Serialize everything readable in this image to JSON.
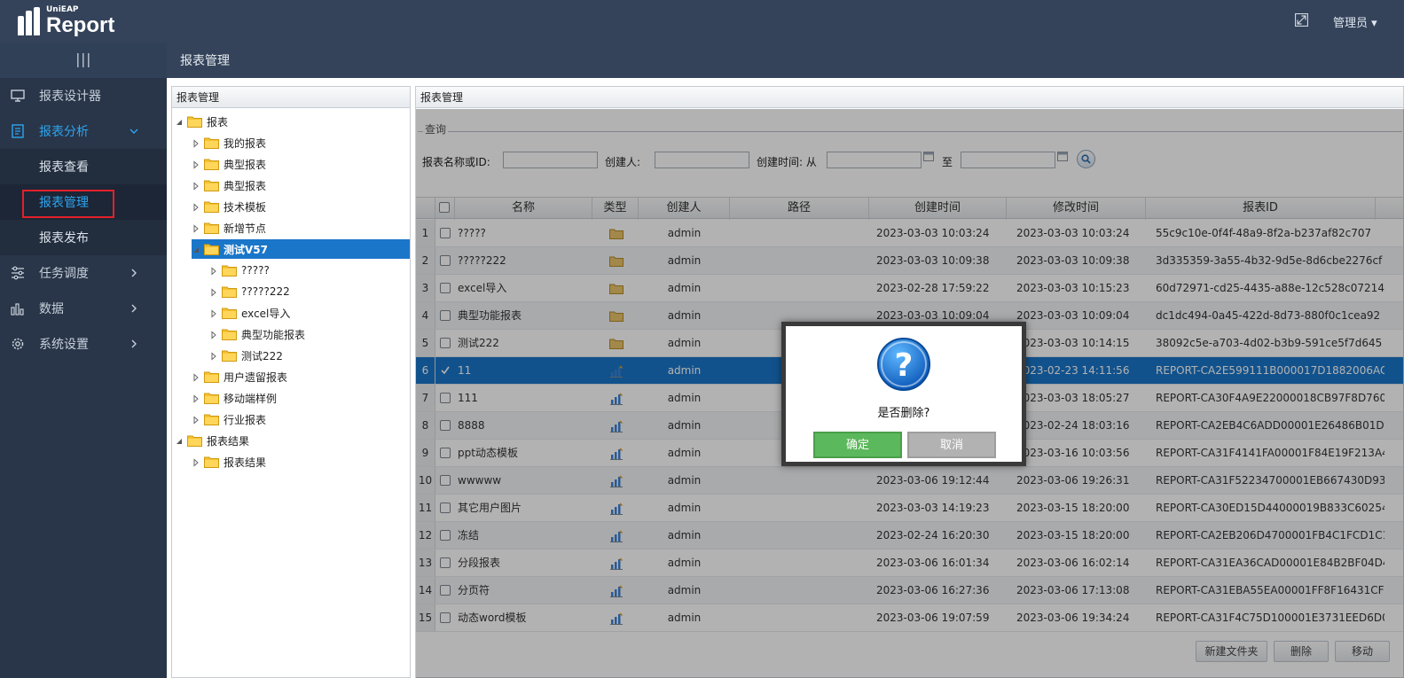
{
  "header": {
    "logo_small": "UniEAP",
    "logo_big": "Report",
    "user_menu": "管理员 ▾"
  },
  "sidebar": {
    "items": [
      {
        "label": "报表设计器",
        "icon": "monitor-icon"
      },
      {
        "label": "报表分析",
        "icon": "document-icon",
        "expanded": true
      },
      {
        "label": "任务调度",
        "icon": "sliders-icon"
      },
      {
        "label": "数据",
        "icon": "bar-chart-icon"
      },
      {
        "label": "系统设置",
        "icon": "gear-icon"
      }
    ],
    "subitems": [
      {
        "label": "报表查看"
      },
      {
        "label": "报表管理",
        "current": true
      },
      {
        "label": "报表发布"
      }
    ]
  },
  "page_title": "报表管理",
  "tree_panel": {
    "title": "报表管理",
    "nodes": [
      {
        "label": "报表"
      },
      {
        "label": "我的报表"
      },
      {
        "label": "典型报表"
      },
      {
        "label": "典型报表"
      },
      {
        "label": "技术模板"
      },
      {
        "label": "新增节点"
      },
      {
        "label": "测试V57",
        "selected": true
      },
      {
        "label": "?????"
      },
      {
        "label": "?????222"
      },
      {
        "label": "excel导入"
      },
      {
        "label": "典型功能报表"
      },
      {
        "label": "测试222"
      },
      {
        "label": "用户遗留报表"
      },
      {
        "label": "移动端样例"
      },
      {
        "label": "行业报表"
      },
      {
        "label": "报表结果"
      },
      {
        "label": "报表结果"
      }
    ]
  },
  "grid_panel": {
    "title": "报表管理",
    "query": {
      "legend": "查询",
      "name_label": "报表名称或ID:",
      "creator_label": "创建人:",
      "time_label": "创建时间: 从",
      "to_label": "至",
      "name_value": "",
      "creator_value": "",
      "from_value": "",
      "to_value": ""
    },
    "columns": [
      "名称",
      "类型",
      "创建人",
      "路径",
      "创建时间",
      "修改时间",
      "报表ID"
    ],
    "rows": [
      {
        "num": "1",
        "name": "?????",
        "type": "folder",
        "creator": "admin",
        "path": "",
        "created": "2023-03-03 10:03:24",
        "modified": "2023-03-03 10:03:24",
        "id": "55c9c10e-0f4f-48a9-8f2a-b237af82c707"
      },
      {
        "num": "2",
        "name": "?????222",
        "type": "folder",
        "creator": "admin",
        "path": "",
        "created": "2023-03-03 10:09:38",
        "modified": "2023-03-03 10:09:38",
        "id": "3d335359-3a55-4b32-9d5e-8d6cbe2276cf"
      },
      {
        "num": "3",
        "name": "excel导入",
        "type": "folder",
        "creator": "admin",
        "path": "",
        "created": "2023-02-28 17:59:22",
        "modified": "2023-03-03 10:15:23",
        "id": "60d72971-cd25-4435-a88e-12c528c07214"
      },
      {
        "num": "4",
        "name": "典型功能报表",
        "type": "folder",
        "creator": "admin",
        "path": "",
        "created": "2023-03-03 10:09:04",
        "modified": "2023-03-03 10:09:04",
        "id": "dc1dc494-0a45-422d-8d73-880f0c1cea92"
      },
      {
        "num": "5",
        "name": "测试222",
        "type": "folder",
        "creator": "admin",
        "path": "",
        "created": "",
        "modified": "2023-03-03 10:14:15",
        "id": "38092c5e-a703-4d02-b3b9-591ce5f7d645"
      },
      {
        "num": "6",
        "name": "11",
        "type": "report",
        "creator": "admin",
        "path": "",
        "created": "",
        "modified": "2023-02-23 14:11:56",
        "id": "REPORT-CA2E599111B000017D1882006ACDB...",
        "selected": true
      },
      {
        "num": "7",
        "name": "111",
        "type": "report",
        "creator": "admin",
        "path": "",
        "created": "",
        "modified": "2023-03-03 18:05:27",
        "id": "REPORT-CA30F4A9E22000018CB97F8D76001..."
      },
      {
        "num": "8",
        "name": "8888",
        "type": "report",
        "creator": "admin",
        "path": "",
        "created": "",
        "modified": "2023-02-24 18:03:16",
        "id": "REPORT-CA2EB4C6ADD00001E26486B01DB5..."
      },
      {
        "num": "9",
        "name": "ppt动态模板",
        "type": "report",
        "creator": "admin",
        "path": "",
        "created": "",
        "modified": "2023-03-16 10:03:56",
        "id": "REPORT-CA31F4141FA00001F84E19F213A41..."
      },
      {
        "num": "10",
        "name": "wwwww",
        "type": "report",
        "creator": "admin",
        "path": "",
        "created": "2023-03-06 19:12:44",
        "modified": "2023-03-06 19:26:31",
        "id": "REPORT-CA31F52234700001EB667430D9309..."
      },
      {
        "num": "11",
        "name": "其它用户图片",
        "type": "report",
        "creator": "admin",
        "path": "",
        "created": "2023-03-03 14:19:23",
        "modified": "2023-03-15 18:20:00",
        "id": "REPORT-CA30ED15D44000019B833C6025471..."
      },
      {
        "num": "12",
        "name": "冻结",
        "type": "report",
        "creator": "admin",
        "path": "",
        "created": "2023-02-24 16:20:30",
        "modified": "2023-03-15 18:20:00",
        "id": "REPORT-CA2EB206D4700001FB4C1FCD1C101..."
      },
      {
        "num": "13",
        "name": "分段报表",
        "type": "report",
        "creator": "admin",
        "path": "",
        "created": "2023-03-06 16:01:34",
        "modified": "2023-03-06 16:02:14",
        "id": "REPORT-CA31EA36CAD00001E84B2BF04D40..."
      },
      {
        "num": "14",
        "name": "分页符",
        "type": "report",
        "creator": "admin",
        "path": "",
        "created": "2023-03-06 16:27:36",
        "modified": "2023-03-06 17:13:08",
        "id": "REPORT-CA31EBA55EA00001FF8F16431CFC1..."
      },
      {
        "num": "15",
        "name": "动态word模板",
        "type": "report",
        "creator": "admin",
        "path": "",
        "created": "2023-03-06 19:07:59",
        "modified": "2023-03-06 19:34:24",
        "id": "REPORT-CA31F4C75D100001E3731EED6D001..."
      }
    ],
    "buttons": {
      "new_folder": "新建文件夹",
      "delete": "删除",
      "move": "移动"
    }
  },
  "dialog": {
    "message": "是否删除?",
    "ok": "确定",
    "cancel": "取消"
  },
  "colors": {
    "header_bg": "#34435a",
    "sidebar_bg": "#293548",
    "accent_blue": "#2da5f0",
    "selection_blue": "#1a76c9",
    "ok_green": "#5cb85c",
    "highlight_red": "#e3202b"
  }
}
